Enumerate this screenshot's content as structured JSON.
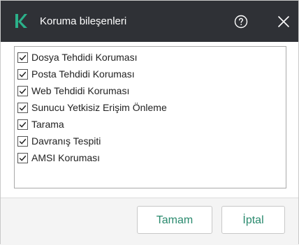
{
  "dialog": {
    "title": "Koruma bileşenleri",
    "logo_icon": "kaspersky-k-logo",
    "help_icon": "help-circle-icon",
    "close_icon": "close-icon",
    "colors": {
      "titlebar_bg": "#2f3136",
      "logo_green": "#2bb18a",
      "button_text": "#2a8a6e"
    }
  },
  "components": [
    {
      "label": "Dosya Tehdidi Koruması",
      "checked": true
    },
    {
      "label": "Posta Tehdidi Koruması",
      "checked": true
    },
    {
      "label": "Web Tehdidi Koruması",
      "checked": true
    },
    {
      "label": "Sunucu Yetkisiz Erişim Önleme",
      "checked": true
    },
    {
      "label": "Tarama",
      "checked": true
    },
    {
      "label": "Davranış Tespiti",
      "checked": true
    },
    {
      "label": "AMSI Koruması",
      "checked": true
    }
  ],
  "footer": {
    "ok_label": "Tamam",
    "cancel_label": "İptal"
  }
}
